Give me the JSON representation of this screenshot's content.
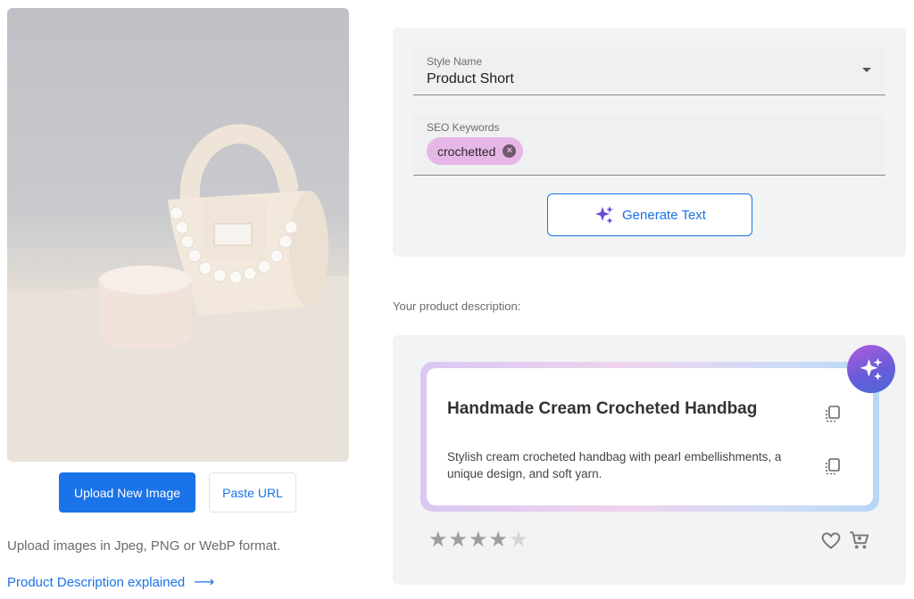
{
  "left": {
    "upload_button": "Upload New Image",
    "paste_button": "Paste URL",
    "hint": "Upload images in Jpeg, PNG or WebP format.",
    "explained_link": "Product Description explained"
  },
  "form": {
    "style_label": "Style Name",
    "style_value": "Product Short",
    "seo_label": "SEO Keywords",
    "seo_chips": [
      "crochetted"
    ],
    "generate_button": "Generate Text"
  },
  "result": {
    "heading": "Your product description:",
    "title": "Handmade Cream Crocheted Handbag",
    "description": "Stylish cream crocheted handbag with pearl embellishments, a unique design, and soft yarn.",
    "rating": 4,
    "rating_max": 5
  },
  "colors": {
    "accent": "#1a73e8",
    "chip": "#e6b7e6",
    "star_filled": "#9e9e9e",
    "star_empty": "#d4d4d4"
  },
  "icons": [
    "sparkle-icon",
    "copy-icon",
    "heart-icon",
    "cart-icon",
    "arrow-right-icon",
    "chip-remove-icon",
    "dropdown-caret-icon"
  ]
}
